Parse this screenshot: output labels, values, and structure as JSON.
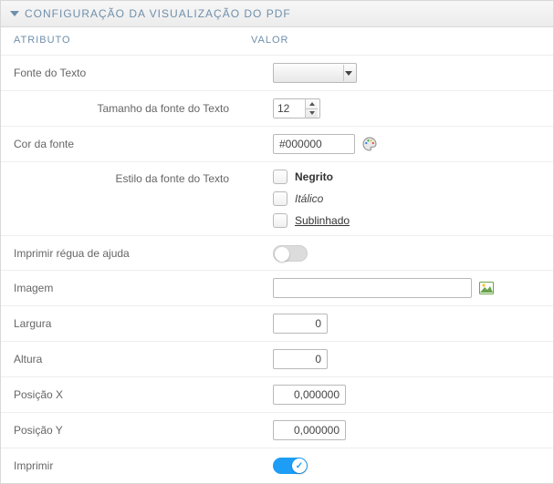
{
  "panel": {
    "title": "CONFIGURAÇÃO DA VISUALIZAÇÃO DO PDF"
  },
  "columns": {
    "attr": "ATRIBUTO",
    "val": "VALOR"
  },
  "rows": {
    "fontFamily": {
      "label": "Fonte do Texto",
      "value": ""
    },
    "fontSize": {
      "label": "Tamanho da fonte do Texto",
      "value": "12"
    },
    "fontColor": {
      "label": "Cor da fonte",
      "value": "#000000"
    },
    "fontStyle": {
      "label": "Estilo da fonte do Texto",
      "options": {
        "bold": "Negrito",
        "italic": "Itálico",
        "underline": "Sublinhado"
      }
    },
    "helpRuler": {
      "label": "Imprimir régua de ajuda",
      "value": false
    },
    "image": {
      "label": "Imagem",
      "value": ""
    },
    "width": {
      "label": "Largura",
      "value": "0"
    },
    "height": {
      "label": "Altura",
      "value": "0"
    },
    "posX": {
      "label": "Posição X",
      "value": "0,000000"
    },
    "posY": {
      "label": "Posição Y",
      "value": "0,000000"
    },
    "print": {
      "label": "Imprimir",
      "value": true
    }
  }
}
